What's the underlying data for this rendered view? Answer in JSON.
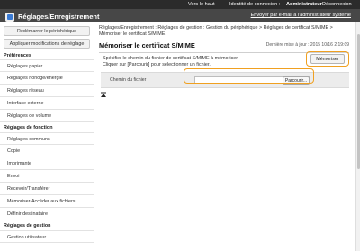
{
  "topbar": {
    "back_link": "Vers le haut",
    "login_label": "Identité de connexion :",
    "login_user": "Administrateur",
    "logout": "Déconnexion"
  },
  "header": {
    "app_title": "Réglages/Enregistrement",
    "mail_link": "Envoyer par e-mail à l'administrateur système"
  },
  "sidebar": {
    "restart_button": "Redémarrer le périphérique",
    "apply_button": "Appliquer modifications de réglage",
    "section_preferences": "Préférences",
    "preferences": [
      "Réglages papier",
      "Réglages horloge/énergie",
      "Réglages réseau",
      "Interface externe",
      "Réglages de volume"
    ],
    "section_function": "Réglages de fonction",
    "functions": [
      "Réglages communs",
      "Copie",
      "Imprimante",
      "Envoi",
      "Recevoir/Transférer",
      "Mémoriser/Accéder aux fichiers",
      "Définir destinataire"
    ],
    "section_management": "Réglages de gestion",
    "management": [
      "Gestion utilisateur"
    ]
  },
  "main": {
    "breadcrumb_line1": "Réglages/Enregistrement : Réglages de gestion : Gestion du périphérique > Réglages de certificat S/MIME >",
    "breadcrumb_line2": "Mémoriser le certificat S/MIME",
    "title": "Mémoriser le certificat S/MIME",
    "last_updated": "Dernière mise à jour : 2015 10/16 2:19:09",
    "instruction_line1": "Spécifier le chemin du fichier de certificat S/MIME à mémoriser.",
    "instruction_line2": "Cliquer sur [Parcourir] pour sélectionner un fichier.",
    "submit_button": "Mémoriser",
    "file_path_label": "Chemin du fichier :",
    "file_path_value": "",
    "browse_button": "Parcourir..."
  },
  "colors": {
    "highlight": "#f0a020",
    "topbar": "#2b2b2b",
    "header": "#474747"
  }
}
